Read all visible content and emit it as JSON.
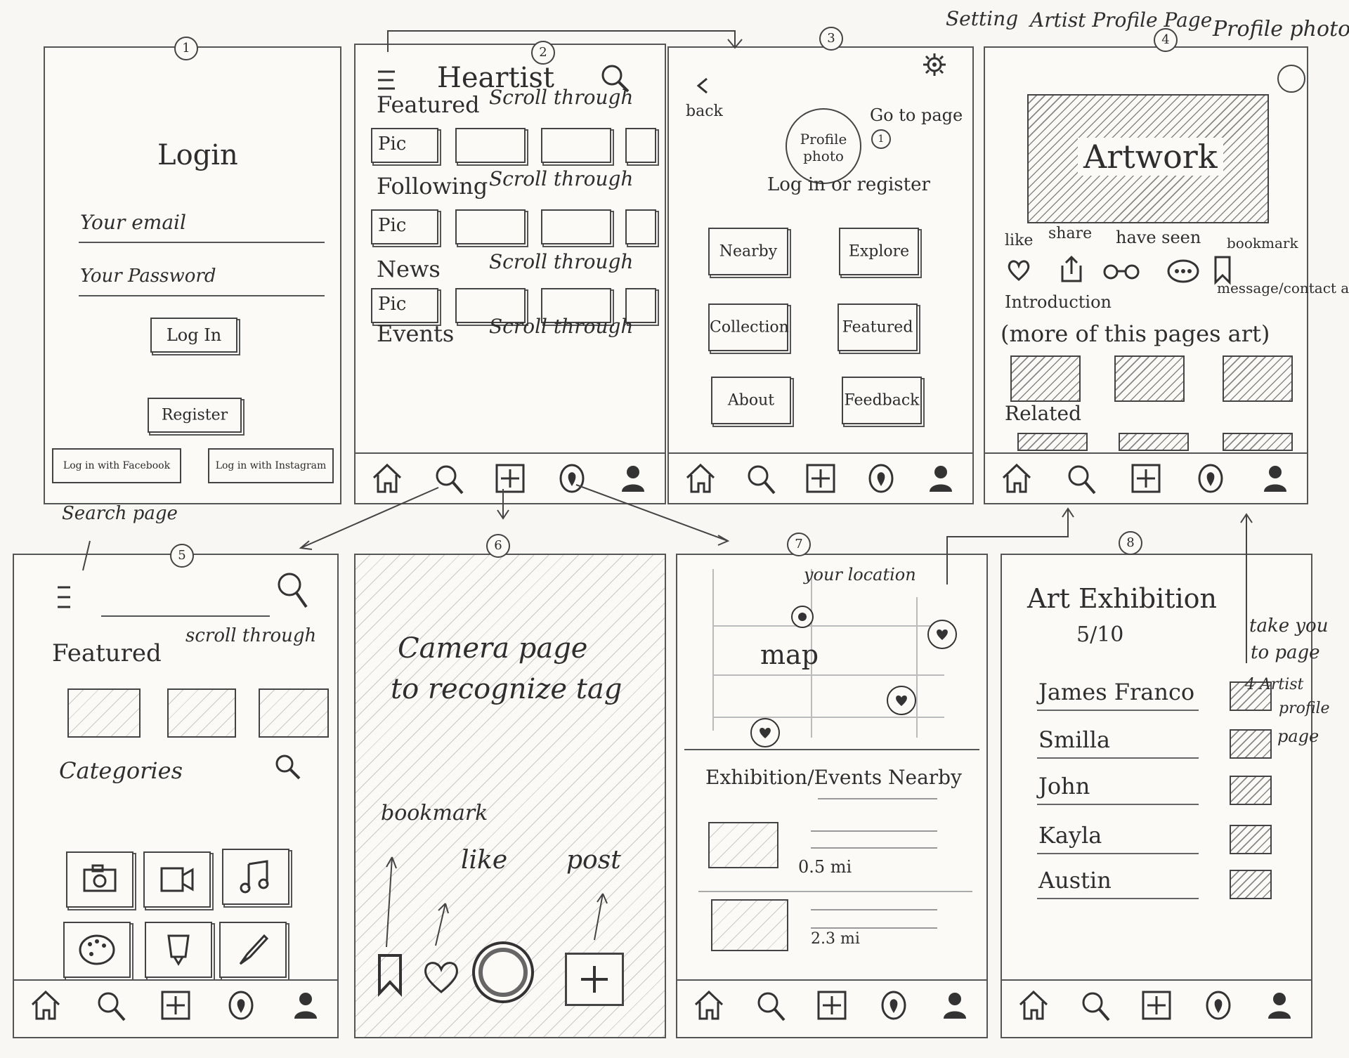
{
  "screens": {
    "s1": {
      "number": "1",
      "title": "Login",
      "email_placeholder": "Your email",
      "password_placeholder": "Your Password",
      "login_button": "Log In",
      "register_button": "Register",
      "facebook_button": "Log in with Facebook",
      "instagram_button": "Log in with Instagram"
    },
    "s2": {
      "number": "2",
      "title": "Heartist",
      "sections": [
        {
          "label": "Featured",
          "note": "Scroll through",
          "first_tile": "Pic"
        },
        {
          "label": "Following",
          "note": "Scroll through",
          "first_tile": "Pic"
        },
        {
          "label": "News",
          "note": "Scroll through",
          "first_tile": "Pic"
        },
        {
          "label": "Events",
          "note": "Scroll through",
          "first_tile": ""
        }
      ]
    },
    "s3": {
      "number": "3",
      "back_label": "back",
      "setting_label": "Setting",
      "profile_photo": "Profile photo",
      "go_to_page": "Go to page",
      "go_to_page_num": "1",
      "login_register": "Log in or register",
      "buttons": [
        "Nearby",
        "Explore",
        "Collection",
        "Featured",
        "About",
        "Feedback"
      ]
    },
    "s4": {
      "number": "4",
      "title": "Artist Profile Page",
      "profile_photo_note": "Profile photo",
      "artwork": "Artwork",
      "like": "like",
      "share": "share",
      "have_seen": "have seen",
      "bookmark": "bookmark",
      "message": "message/contact artist",
      "introduction": "Introduction",
      "more": "(more of this pages art)",
      "related": "Related"
    },
    "s5": {
      "number": "5",
      "note": "Search page",
      "featured": "Featured",
      "scroll": "scroll through",
      "categories": "Categories"
    },
    "s6": {
      "number": "6",
      "text_line1": "Camera page",
      "text_line2": "to recognize tag",
      "bookmark": "bookmark",
      "like": "like",
      "post": "post"
    },
    "s7": {
      "number": "7",
      "your_location": "your location",
      "map": "map",
      "nearby": "Exhibition/Events Nearby",
      "distance1": "0.5 mi",
      "distance2": "2.3 mi"
    },
    "s8": {
      "number": "8",
      "title": "Art Exhibition",
      "date": "5/10",
      "artists": [
        "James Franco",
        "Smilla",
        "John",
        "Kayla",
        "Austin"
      ],
      "note_line1": "take you",
      "note_line2": "to page",
      "note_line3": "4 Artist",
      "note_line4": "profile",
      "note_line5": "page"
    }
  },
  "icons": [
    "menu-icon",
    "search-icon",
    "home-icon",
    "add-icon",
    "location-icon",
    "person-icon",
    "gear-icon",
    "heart-icon",
    "share-icon",
    "glasses-icon",
    "message-icon",
    "bookmark-icon",
    "camera-icon",
    "video-icon",
    "music-icon",
    "palette-icon",
    "sculpture-icon",
    "brush-icon",
    "shutter-icon",
    "back-icon"
  ],
  "colors": {
    "paper": "#f8f7f4",
    "ink": "#2b2b2b"
  }
}
